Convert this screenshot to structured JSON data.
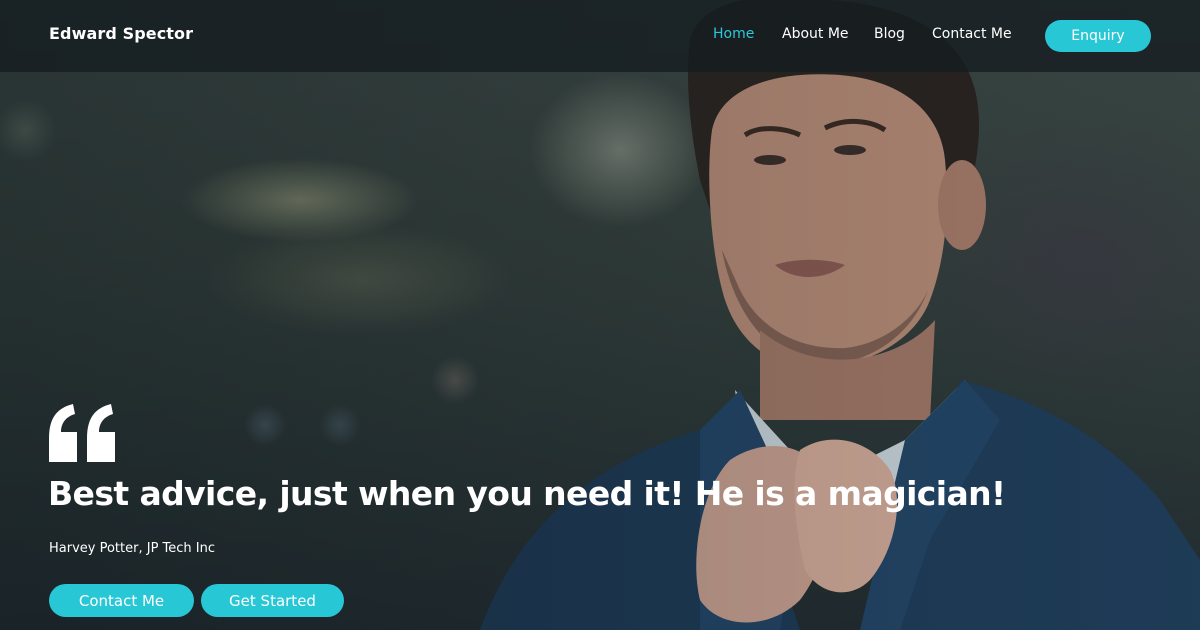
{
  "brand": {
    "name": "Edward Spector"
  },
  "nav": {
    "items": [
      {
        "label": "Home",
        "active": true
      },
      {
        "label": "About Me",
        "active": false
      },
      {
        "label": "Blog",
        "active": false
      },
      {
        "label": "Contact Me",
        "active": false
      }
    ],
    "enquiry_label": "Enquiry"
  },
  "hero": {
    "quote_icon": "quote-icon",
    "headline": "Best advice, just when you need it! He is a magician!",
    "attribution": "Harvey Potter, JP Tech Inc",
    "buttons": {
      "contact_label": "Contact Me",
      "start_label": "Get Started"
    }
  },
  "colors": {
    "accent": "#28c7d6",
    "active_link": "#2bc8d8",
    "text": "#ffffff",
    "navbar": "#141c20"
  }
}
